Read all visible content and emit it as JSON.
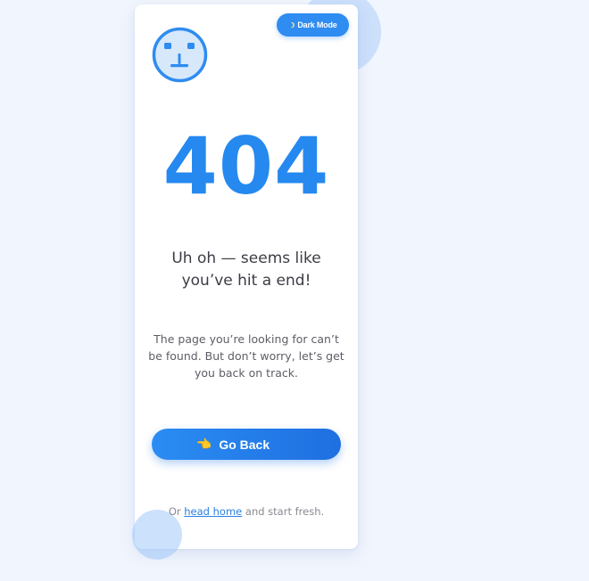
{
  "toggle": {
    "icon": "moon-icon",
    "glyph": "☽",
    "label": "Dark Mode"
  },
  "face_icon": "robot-face-icon",
  "error": {
    "code": "404",
    "headline_line1": "Uh oh — seems like",
    "headline_line2": "you’ve hit a end!",
    "description": "The page you’re looking for can’t be found. But don’t worry, let’s get you back on track."
  },
  "go_back": {
    "icon": "pointing-hand-icon",
    "glyph": "👈",
    "label": "Go Back"
  },
  "footer": {
    "prefix": "Or",
    "link_text": "head home",
    "suffix": "and start fresh."
  },
  "colors": {
    "accent": "#2589ef",
    "background": "#f1f5fd",
    "card": "#ffffff"
  }
}
